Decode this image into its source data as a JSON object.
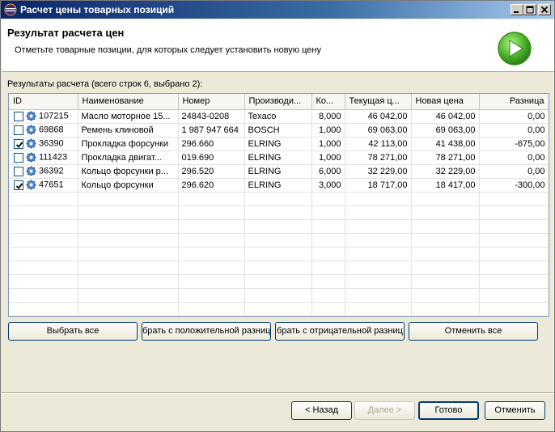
{
  "window": {
    "title": "Расчет цены товарных позиций"
  },
  "header": {
    "title": "Результат расчета цен",
    "description": "Отметьте товарные позиции, для которых следует установить новую цену"
  },
  "results_label": "Результаты расчета (всего строк 6, выбрано 2):",
  "table": {
    "columns": [
      "ID",
      "Наименование",
      "Номер",
      "Производи...",
      "Ко...",
      "Текущая ц...",
      "Новая цена",
      "Разница"
    ],
    "rows": [
      {
        "checked": false,
        "id": "107215",
        "name": "Масло моторное 15...",
        "number": "24843-0208",
        "maker": "Texaco",
        "qty": "8,000",
        "current": "46 042,00",
        "new": "46 042,00",
        "diff": "0,00"
      },
      {
        "checked": false,
        "id": "69868",
        "name": "Ремень клиновой",
        "number": "1 987 947 664",
        "maker": "BOSCH",
        "qty": "1,000",
        "current": "69 063,00",
        "new": "69 063,00",
        "diff": "0,00"
      },
      {
        "checked": true,
        "id": "36390",
        "name": "Прокладка форсунки",
        "number": "296.660",
        "maker": "ELRING",
        "qty": "1,000",
        "current": "42 113,00",
        "new": "41 438,00",
        "diff": "-675,00"
      },
      {
        "checked": false,
        "id": "111423",
        "name": "Прокладка двигат...",
        "number": "019.690",
        "maker": "ELRING",
        "qty": "1,000",
        "current": "78 271,00",
        "new": "78 271,00",
        "diff": "0,00"
      },
      {
        "checked": false,
        "id": "36392",
        "name": "Кольцо форсунки р...",
        "number": "296.520",
        "maker": "ELRING",
        "qty": "6,000",
        "current": "32 229,00",
        "new": "32 229,00",
        "diff": "0,00"
      },
      {
        "checked": true,
        "id": "47651",
        "name": "Кольцо форсунки",
        "number": "296.620",
        "maker": "ELRING",
        "qty": "3,000",
        "current": "18 717,00",
        "new": "18 417,00",
        "diff": "-300,00"
      }
    ]
  },
  "selection_buttons": {
    "select_all": "Выбрать все",
    "select_positive": "брать с положительной разниц",
    "select_negative": "брать с отрицательной разниц",
    "deselect_all": "Отменить все"
  },
  "footer": {
    "back": "< Назад",
    "next": "Далее >",
    "finish": "Готово",
    "cancel": "Отменить"
  },
  "icons": {
    "app": "eclipse-icon",
    "row": "gear-icon",
    "header": "play-icon"
  }
}
